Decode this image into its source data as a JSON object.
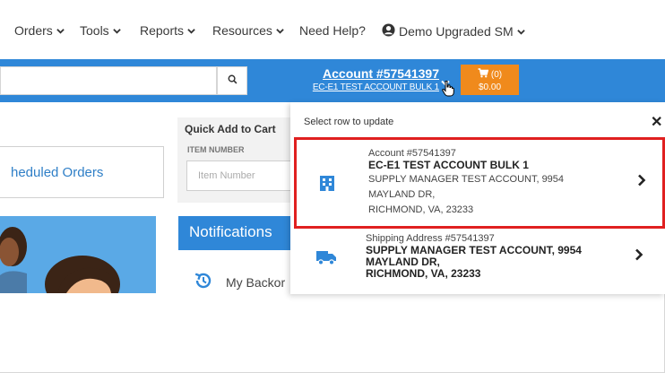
{
  "nav": {
    "orders": "Orders",
    "tools": "Tools",
    "reports": "Reports",
    "resources": "Resources",
    "help": "Need Help?",
    "user": "Demo Upgraded SM"
  },
  "header": {
    "account_number": "Account #57541397",
    "account_name": "EC-E1 TEST ACCOUNT BULK 1",
    "cart_count": "(0)",
    "cart_total": "$0.00"
  },
  "main": {
    "scheduled_orders": "heduled Orders",
    "quick_add": {
      "title": "Quick Add to Cart",
      "item_label": "ITEM NUMBER",
      "item_placeholder": "Item Number"
    },
    "notifications": {
      "title": "Notifications",
      "item": "My Backor"
    }
  },
  "panel": {
    "title": "Select row to update",
    "close": "✕",
    "rows": [
      {
        "line1": "Account #57541397",
        "line2": "EC-E1 TEST ACCOUNT BULK 1",
        "line3": "SUPPLY MANAGER TEST ACCOUNT, 9954",
        "line4": "MAYLAND DR,",
        "line5": "RICHMOND, VA, 23233",
        "icon": "building-icon"
      },
      {
        "line1": "Shipping Address #57541397",
        "line2": "SUPPLY MANAGER TEST ACCOUNT, 9954",
        "line3": "MAYLAND DR,",
        "line4": "RICHMOND, VA, 23233",
        "icon": "truck-icon"
      }
    ]
  },
  "colors": {
    "brand_blue": "#2f87d8",
    "cart_orange": "#f08a1c",
    "highlight_red": "#e02020"
  }
}
